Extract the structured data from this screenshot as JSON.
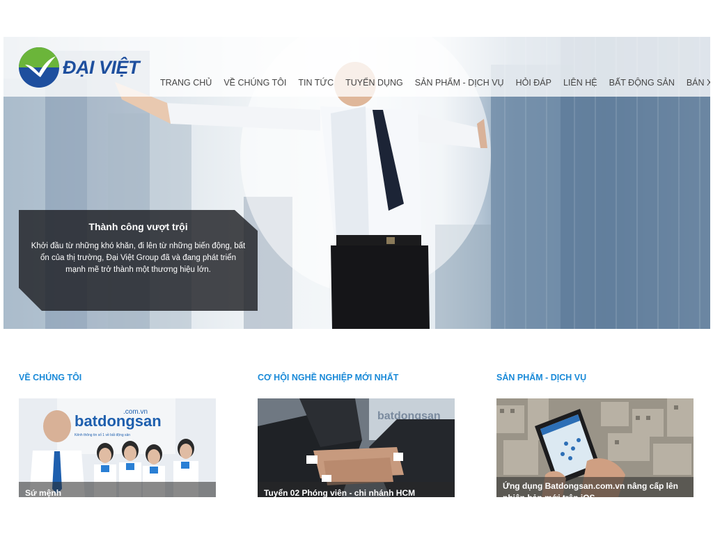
{
  "brand": {
    "name": "ĐẠI VIỆT"
  },
  "nav": {
    "items": [
      {
        "label": "TRANG CHỦ"
      },
      {
        "label": "VỀ CHÚNG TÔI"
      },
      {
        "label": "TIN TỨC"
      },
      {
        "label": "TUYỂN DỤNG"
      },
      {
        "label": "SẢN PHẨM - DỊCH VỤ"
      },
      {
        "label": "HỎI ĐÁP"
      },
      {
        "label": "LIÊN HỆ"
      },
      {
        "label": "BẤT ĐỘNG SẢN"
      },
      {
        "label": "BÁN XE HƠI"
      }
    ]
  },
  "hero": {
    "caption_title": "Thành công vượt trội",
    "caption_text": "Khởi đầu từ những khó khăn, đi lên từ những biến động, bất ổn của thị trường, Đại Việt Group đã và đang phát triển mạnh mẽ trở thành một thương hiệu lớn."
  },
  "sections": [
    {
      "title": "VỀ CHÚNG TÔI",
      "card_caption": "Sứ mệnh",
      "image_sign_text": "batdongsan",
      "image_sign_domain": ".com.vn",
      "image_sign_slogan": "Kênh thông tin số 1 về bất động sản"
    },
    {
      "title": "CƠ HỘI NGHỀ NGHIỆP MỚI NHẤT",
      "card_caption": "Tuyển 02 Phóng viên - chi nhánh HCM",
      "image_sign_text": "batdongsan"
    },
    {
      "title": "SẢN PHẨM - DỊCH VỤ",
      "card_caption": "Ứng dụng Batdongsan.com.vn nâng cấp lên phiên bản mới trên iOS"
    }
  ],
  "colors": {
    "accent": "#1a8ad8",
    "logo_blue": "#1e4f9e",
    "logo_green": "#6bb53a"
  }
}
